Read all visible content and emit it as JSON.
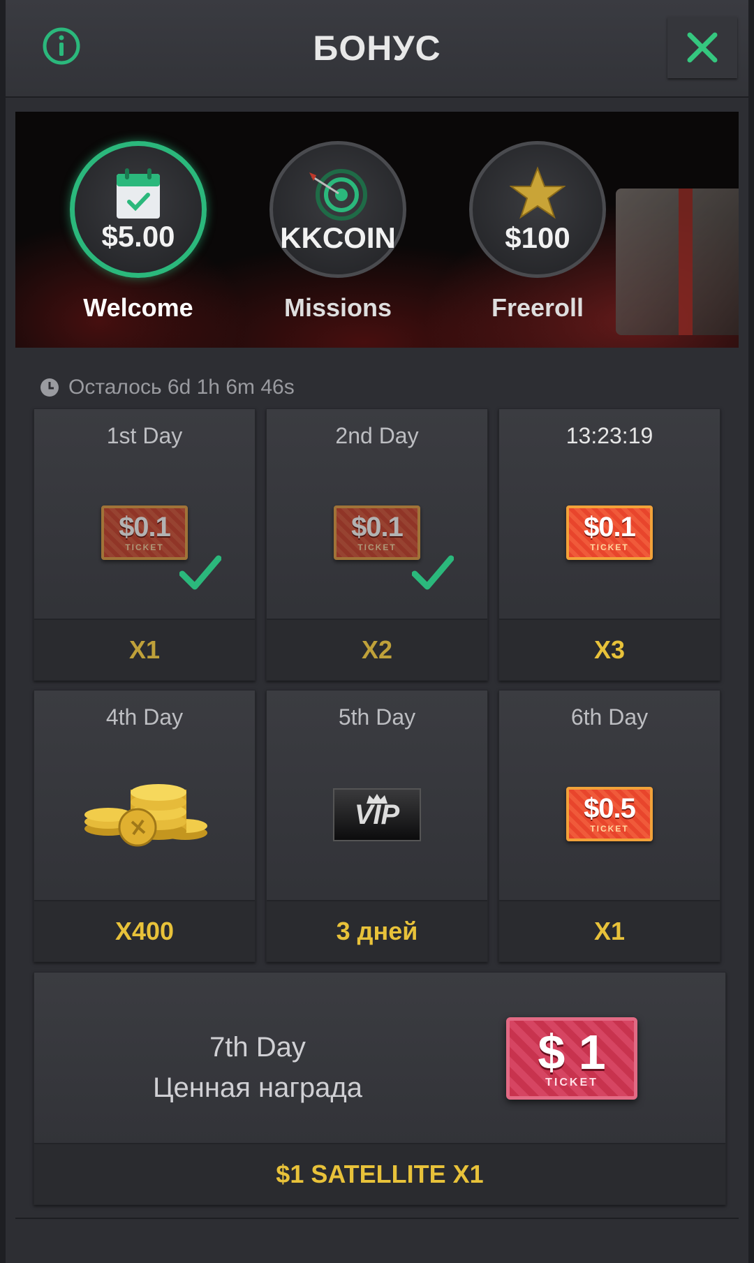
{
  "header": {
    "title": "БОНУС"
  },
  "colors": {
    "accent": "#2bb87c",
    "gold": "#e8c23a"
  },
  "tabs": [
    {
      "value": "$5.00",
      "label": "Welcome",
      "icon": "calendar-icon",
      "active": true
    },
    {
      "value": "KKCOIN",
      "label": "Missions",
      "icon": "target-icon",
      "active": false
    },
    {
      "value": "$100",
      "label": "Freeroll",
      "icon": "star-icon",
      "active": false
    }
  ],
  "countdown": {
    "text": "Осталось 6d 1h 6m 46s"
  },
  "days": [
    {
      "title": "1st Day",
      "ticket": "$0.1",
      "ticket_word": "TICKET",
      "reward": "X1",
      "claimed": true
    },
    {
      "title": "2nd Day",
      "ticket": "$0.1",
      "ticket_word": "TICKET",
      "reward": "X2",
      "claimed": true
    },
    {
      "title": "13:23:19",
      "ticket": "$0.1",
      "ticket_word": "TICKET",
      "reward": "X3",
      "claimed": false
    },
    {
      "title": "4th Day",
      "prize": "coins-icon",
      "reward": "X400",
      "claimed": false
    },
    {
      "title": "5th Day",
      "vip": "VIP",
      "reward": "3 дней",
      "claimed": false
    },
    {
      "title": "6th Day",
      "ticket": "$0.5",
      "ticket_word": "TICKET",
      "reward": "X1",
      "claimed": false
    }
  ],
  "final": {
    "title": "7th Day",
    "subtitle": "Ценная награда",
    "ticket": "$ 1",
    "ticket_word": "TICKET",
    "reward": "$1 SATELLITE X1"
  }
}
